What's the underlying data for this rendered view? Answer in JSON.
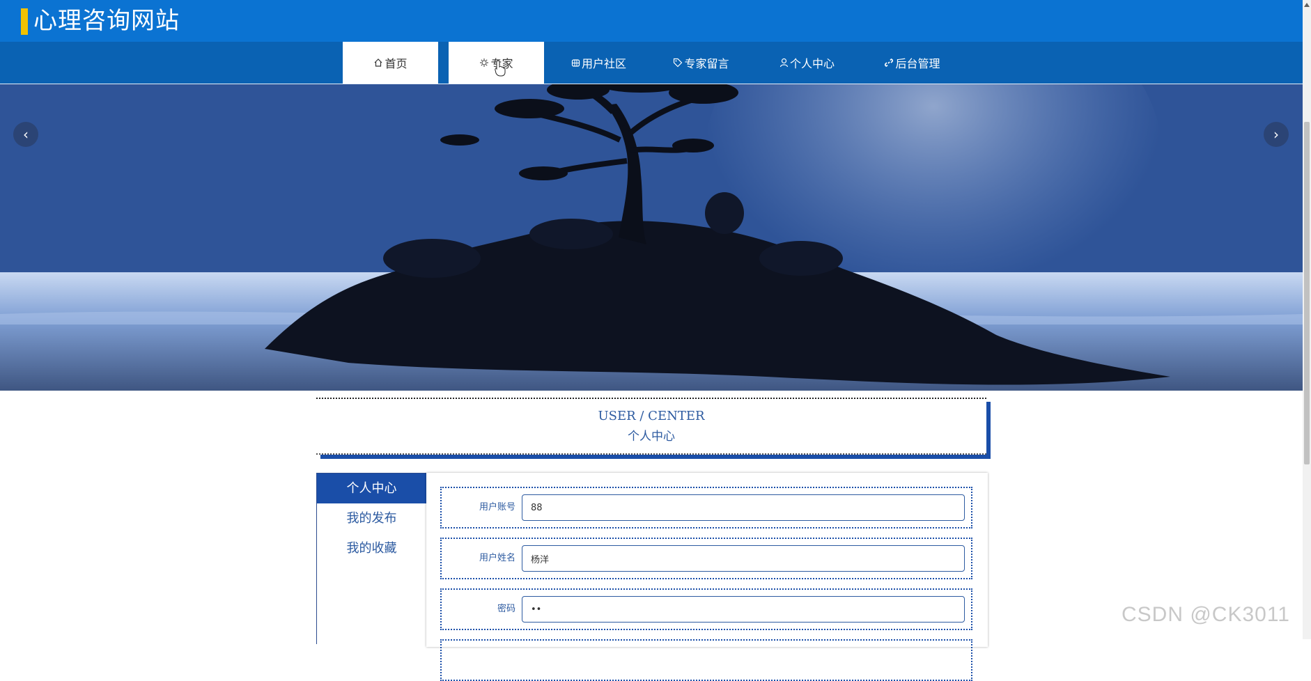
{
  "header": {
    "site_title": "心理咨询网站",
    "accent_color": "#f2c200",
    "bg_color": "#0b73d2"
  },
  "nav": {
    "items": [
      {
        "label": "首页",
        "icon": "home-icon",
        "active": true
      },
      {
        "label": "专家",
        "icon": "gear-icon",
        "active": true
      },
      {
        "label": "用户社区",
        "icon": "grid-icon",
        "active": false
      },
      {
        "label": "专家留言",
        "icon": "tag-icon",
        "active": false
      },
      {
        "label": "个人中心",
        "icon": "user-icon",
        "active": false
      },
      {
        "label": "后台管理",
        "icon": "link-icon",
        "active": false
      }
    ]
  },
  "banner": {
    "prev_icon": "chevron-left-icon",
    "next_icon": "chevron-right-icon",
    "prev_glyph": "‹",
    "next_glyph": "›"
  },
  "section": {
    "title_en": "USER / CENTER",
    "title_zh": "个人中心"
  },
  "sidebar": {
    "items": [
      {
        "label": "个人中心",
        "active": true
      },
      {
        "label": "我的发布",
        "active": false
      },
      {
        "label": "我的收藏",
        "active": false
      }
    ]
  },
  "form": {
    "fields": [
      {
        "label": "用户账号",
        "value": "88"
      },
      {
        "label": "用户姓名",
        "value": "杨洋"
      },
      {
        "label": "密码",
        "value": "••"
      }
    ]
  },
  "watermark": "CSDN @CK3011"
}
